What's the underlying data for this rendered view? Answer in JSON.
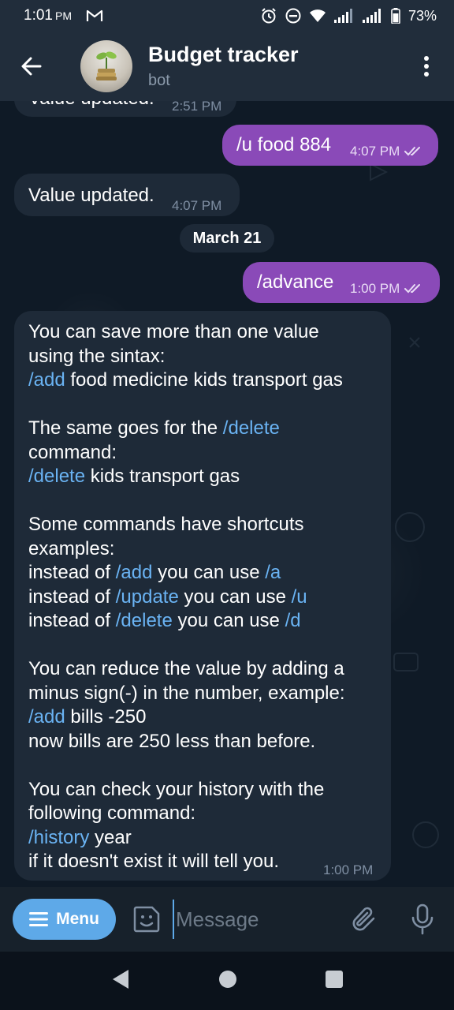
{
  "status_bar": {
    "time": "1:01",
    "ampm": "PM",
    "battery": "73%",
    "icons": [
      "gmail-icon",
      "alarm-icon",
      "do-not-disturb-icon",
      "wifi-icon",
      "signal-icon",
      "signal-icon-2",
      "battery-icon"
    ]
  },
  "header": {
    "title": "Budget tracker",
    "subtitle": "bot"
  },
  "messages": [
    {
      "id": "m0",
      "direction": "in",
      "text": "Value updated.",
      "time": "2:51 PM"
    },
    {
      "id": "m1",
      "direction": "out",
      "text": "/u food 884",
      "time": "4:07 PM",
      "status": "read"
    },
    {
      "id": "m2",
      "direction": "in",
      "text": "Value updated.",
      "time": "4:07 PM"
    },
    {
      "id": "m3",
      "direction": "out",
      "text": "/advance",
      "time": "1:00 PM",
      "status": "read"
    },
    {
      "id": "m4",
      "direction": "in",
      "time": "1:00 PM",
      "lines": [
        [
          {
            "t": "You can save more than one value"
          }
        ],
        [
          {
            "t": "using the sintax:"
          }
        ],
        [
          {
            "t": "/add",
            "cmd": true
          },
          {
            "t": " food medicine kids transport gas"
          }
        ],
        [],
        [
          {
            "t": "The same goes for the "
          },
          {
            "t": "/delete",
            "cmd": true
          }
        ],
        [
          {
            "t": "command:"
          }
        ],
        [
          {
            "t": "/delete",
            "cmd": true
          },
          {
            "t": " kids transport gas"
          }
        ],
        [],
        [
          {
            "t": "Some commands have shortcuts"
          }
        ],
        [
          {
            "t": "examples:"
          }
        ],
        [
          {
            "t": "instead of "
          },
          {
            "t": "/add",
            "cmd": true
          },
          {
            "t": " you can use "
          },
          {
            "t": "/a",
            "cmd": true
          }
        ],
        [
          {
            "t": "instead of "
          },
          {
            "t": "/update",
            "cmd": true
          },
          {
            "t": " you can use "
          },
          {
            "t": "/u",
            "cmd": true
          }
        ],
        [
          {
            "t": "instead of "
          },
          {
            "t": "/delete",
            "cmd": true
          },
          {
            "t": " you can use "
          },
          {
            "t": "/d",
            "cmd": true
          }
        ],
        [],
        [
          {
            "t": "You can reduce the value by adding a"
          }
        ],
        [
          {
            "t": "minus sign(-) in the number, example:"
          }
        ],
        [
          {
            "t": "/add",
            "cmd": true
          },
          {
            "t": " bills -250"
          }
        ],
        [
          {
            "t": "now bills are 250 less than before."
          }
        ],
        [],
        [
          {
            "t": "You can check your history with the"
          }
        ],
        [
          {
            "t": "following command:"
          }
        ],
        [
          {
            "t": "/history",
            "cmd": true
          },
          {
            "t": " year"
          }
        ],
        [
          {
            "t": "if it doesn't exist it will tell you."
          }
        ]
      ]
    }
  ],
  "date_separator": "March 21",
  "input_bar": {
    "menu_label": "Menu",
    "placeholder": "Message"
  },
  "colors": {
    "accent": "#5ea9e8",
    "outgoing_bubble": "#8a4ab8",
    "incoming_bubble": "#1e2a38",
    "command_link": "#6ab3f3"
  }
}
